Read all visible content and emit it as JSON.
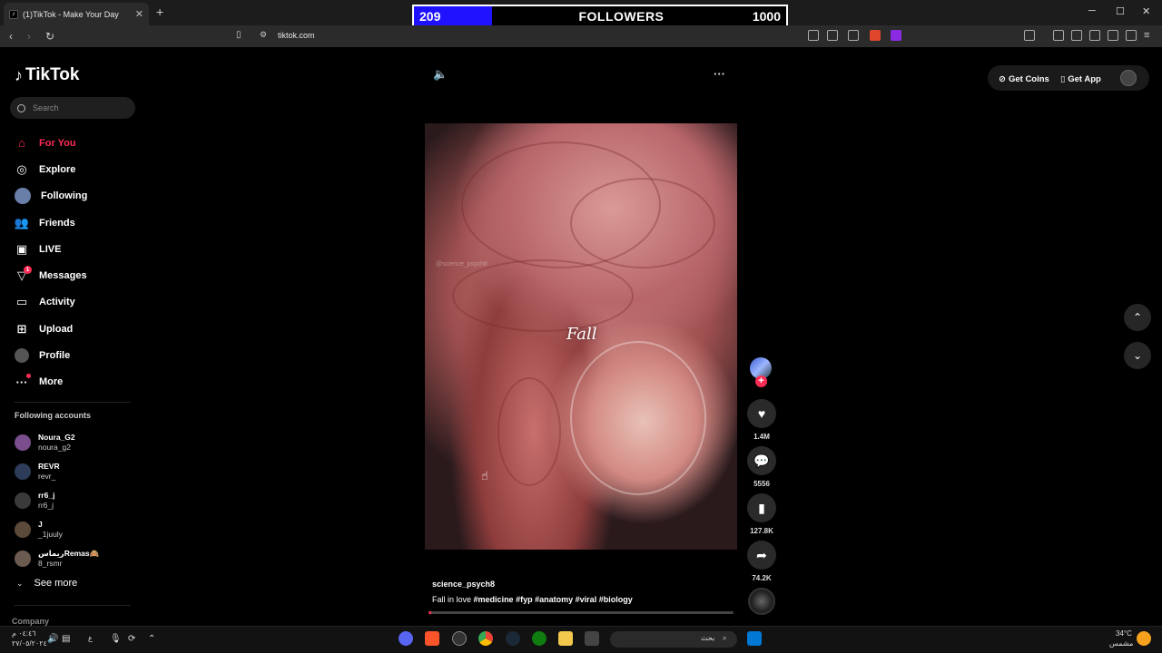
{
  "browser": {
    "tab_title": "(1)TikTok - Make Your Day",
    "tab_close": "✕",
    "new_tab": "+",
    "url": "tiktok.com",
    "win_min": "─",
    "win_max": "☐",
    "win_close": "✕"
  },
  "overlay": {
    "current": "209",
    "label": "FOLLOWERS",
    "goal": "1000",
    "progress_fraction": 0.209,
    "fill_color": "#1e12ff"
  },
  "sidebar": {
    "logo_text": "TikTok",
    "search_placeholder": "Search",
    "items": [
      {
        "label": "For You",
        "icon": "home-icon",
        "active": true
      },
      {
        "label": "Explore",
        "icon": "compass-icon"
      },
      {
        "label": "Following",
        "icon": "following-avatar-icon"
      },
      {
        "label": "Friends",
        "icon": "friends-icon"
      },
      {
        "label": "LIVE",
        "icon": "live-icon"
      },
      {
        "label": "Messages",
        "icon": "messages-icon",
        "badge": "1"
      },
      {
        "label": "Activity",
        "icon": "activity-icon"
      },
      {
        "label": "Upload",
        "icon": "upload-icon"
      },
      {
        "label": "Profile",
        "icon": "profile-icon"
      },
      {
        "label": "More",
        "icon": "more-icon"
      }
    ],
    "following_title": "Following accounts",
    "accounts": [
      {
        "name": "Noura_G2",
        "handle": "noura_g2"
      },
      {
        "name": "REVR",
        "handle": "revr_"
      },
      {
        "name": "rr6_j",
        "handle": "rr6_j"
      },
      {
        "name": "J",
        "handle": "_1juuly"
      },
      {
        "name": "ريماسRemas🙈",
        "handle": "8_rsmr"
      }
    ],
    "see_more": "See more",
    "company": "Company"
  },
  "video": {
    "caption": "Fall",
    "watermark": "@science_psych8",
    "author": "science_psych8",
    "desc_prefix": "Fall in love",
    "tags": [
      "#medicine",
      "#fyp",
      "#anatomy",
      "#viral",
      "#biology"
    ],
    "progress_fraction": 0.01
  },
  "actions": {
    "follow": "+",
    "likes": "1.4M",
    "comments": "5556",
    "saves": "127.8K",
    "shares": "74.2K"
  },
  "topright": {
    "get_coins": "Get Coins",
    "get_app": "Get App"
  },
  "taskbar": {
    "time": "٠٤:٤٦ م",
    "date": "٢٧/٠٥/٢٠٢٤",
    "search_text": "بحث",
    "weather_temp": "34°C",
    "weather_text": "مشمس"
  },
  "colors": {
    "accent": "#fe2c55",
    "background": "#000000",
    "panel": "#1f1f1f"
  }
}
